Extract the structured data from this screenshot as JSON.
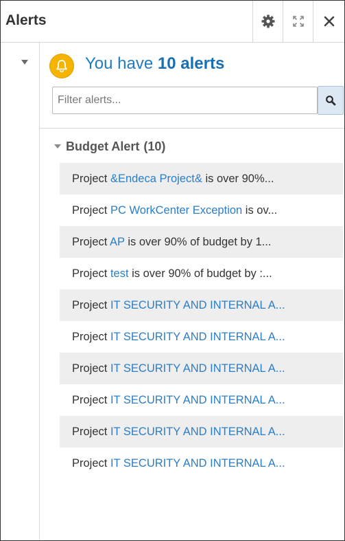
{
  "header": {
    "title": "Alerts",
    "settings_icon": "gear-icon",
    "expand_icon": "expand-icon",
    "close_icon": "close-icon"
  },
  "summary": {
    "prefix": "You have ",
    "count_text": "10 alerts",
    "bell_icon": "bell-icon",
    "bell_color": "#f5b400"
  },
  "filter": {
    "placeholder": "Filter alerts...",
    "value": "",
    "search_icon": "search-icon"
  },
  "group": {
    "label": "Budget Alert",
    "count": "(10)"
  },
  "alerts": [
    {
      "prefix": "Project ",
      "project": "&Endeca Project&",
      "suffix": " is over 90%..."
    },
    {
      "prefix": "Project ",
      "project": "PC WorkCenter Exception",
      "suffix": " is ov..."
    },
    {
      "prefix": "Project ",
      "project": "AP",
      "suffix": " is over 90% of budget by 1..."
    },
    {
      "prefix": "Project ",
      "project": "test",
      "suffix": " is over 90% of budget by :..."
    },
    {
      "prefix": "Project ",
      "project": "IT SECURITY AND INTERNAL A...",
      "suffix": ""
    },
    {
      "prefix": "Project ",
      "project": "IT SECURITY AND INTERNAL A...",
      "suffix": ""
    },
    {
      "prefix": "Project ",
      "project": "IT SECURITY AND INTERNAL A...",
      "suffix": ""
    },
    {
      "prefix": "Project ",
      "project": "IT SECURITY AND INTERNAL A...",
      "suffix": ""
    },
    {
      "prefix": "Project ",
      "project": "IT SECURITY AND INTERNAL A...",
      "suffix": ""
    },
    {
      "prefix": "Project ",
      "project": "IT SECURITY AND INTERNAL A...",
      "suffix": ""
    }
  ],
  "colors": {
    "link": "#2a7ec9",
    "summary_text": "#1f7bc4",
    "row_shade": "#eeeeee"
  }
}
